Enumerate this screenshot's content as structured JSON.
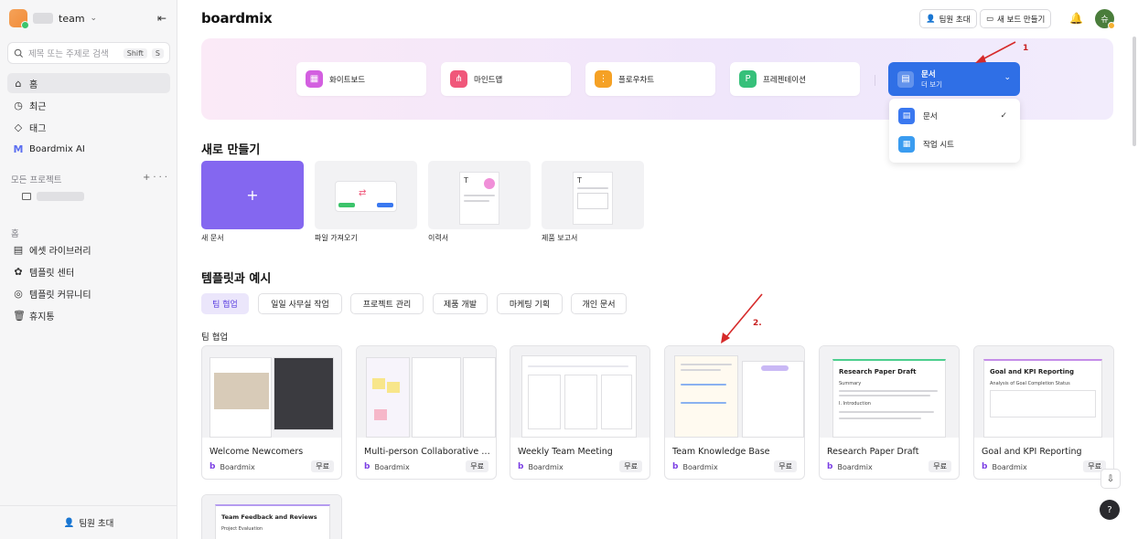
{
  "sidebar": {
    "team_name": "team",
    "search_placeholder": "제목 또는 주제로 검색",
    "search_shortcut_1": "Shift",
    "search_shortcut_2": "S",
    "nav": [
      {
        "label": "홈",
        "icon": "home-icon"
      },
      {
        "label": "최근",
        "icon": "clock-icon"
      },
      {
        "label": "태그",
        "icon": "tag-icon"
      },
      {
        "label": "Boardmix AI",
        "icon": "ai-icon"
      }
    ],
    "projects_label": "모든 프로젝트",
    "home_section_label": "홈",
    "nav2": [
      {
        "label": "에셋 라이브러리"
      },
      {
        "label": "템플릿 센터"
      },
      {
        "label": "템플릿 커뮤니티"
      },
      {
        "label": "휴지통"
      }
    ],
    "invite_label": "팀원 초대"
  },
  "header": {
    "logo": "boardmix",
    "invite_btn": "팀원 초대",
    "new_board_btn": "새 보드 만들기",
    "avatar_text": "슈"
  },
  "banner": {
    "tools": [
      {
        "label": "화이트보드",
        "color": "#d35fe0"
      },
      {
        "label": "마인드맵",
        "color": "#f0577a"
      },
      {
        "label": "플로우차트",
        "color": "#f5a125"
      },
      {
        "label": "프레젠테이션",
        "color": "#36c07a"
      }
    ],
    "doc_btn_title": "문서",
    "doc_btn_sub": "더 보기"
  },
  "dropdown": {
    "items": [
      {
        "label": "문서",
        "color": "#3a78f0"
      },
      {
        "label": "작업 시트",
        "color": "#3a9cf0"
      }
    ]
  },
  "annotations": {
    "a1": "1",
    "a2": "2."
  },
  "new_section": {
    "title": "새로 만들기",
    "cards": [
      {
        "label": "새 문서"
      },
      {
        "label": "파일 가져오기"
      },
      {
        "label": "이력서"
      },
      {
        "label": "제품 보고서"
      }
    ]
  },
  "templates": {
    "title": "템플릿과 예시",
    "tabs": [
      "팀 협업",
      "일일 사무실 작업",
      "프로젝트 관리",
      "제품 개발",
      "마케팅 기획",
      "개인 문서"
    ],
    "subsection": "팀 협업",
    "cards": [
      {
        "name": "Welcome Newcomers",
        "author": "Boardmix",
        "badge": "무료"
      },
      {
        "name": "Multi-person Collaborative Wr...",
        "author": "Boardmix",
        "badge": "무료"
      },
      {
        "name": "Weekly Team Meeting",
        "author": "Boardmix",
        "badge": "무료"
      },
      {
        "name": "Team Knowledge Base",
        "author": "Boardmix",
        "badge": "무료"
      },
      {
        "name": "Research Paper Draft",
        "author": "Boardmix",
        "badge": "무료",
        "thumb_title": "Research Paper Draft",
        "thumb_sub": "Summary",
        "thumb_h": "I. Introduction"
      },
      {
        "name": "Goal and KPI Reporting",
        "author": "Boardmix",
        "badge": "무료",
        "thumb_title": "Goal and KPI Reporting",
        "thumb_sub": "Analysis of Goal Completion Status"
      }
    ],
    "extra_card": {
      "thumb_title": "Team Feedback and Reviews",
      "thumb_sub": "Project Evaluation"
    }
  },
  "float": {
    "help": "?"
  }
}
